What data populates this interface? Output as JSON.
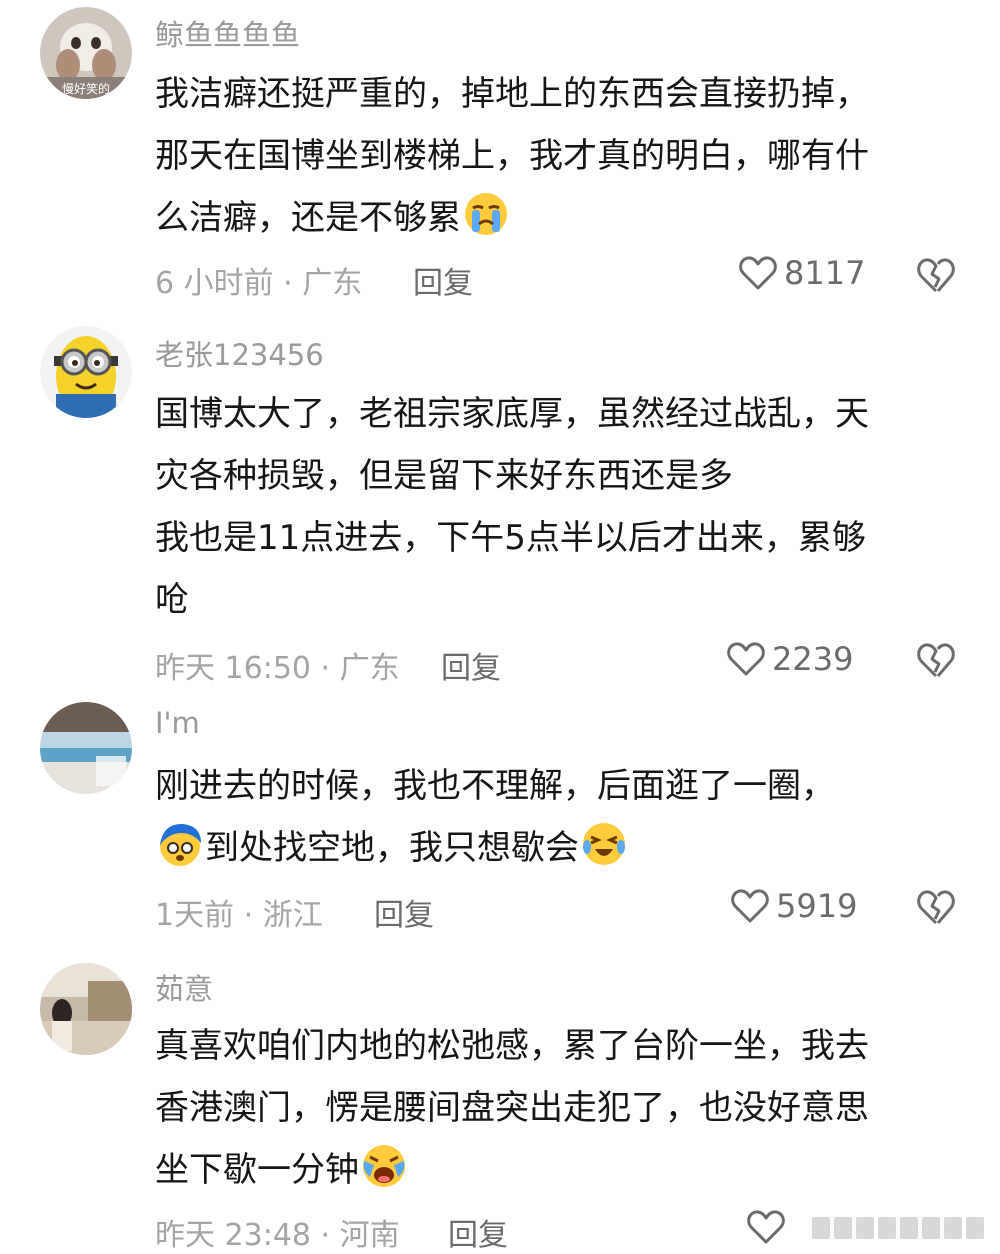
{
  "comments": [
    {
      "username": "鲸鱼鱼鱼鱼",
      "avatar_label": "慢好笑的",
      "lines": [
        "我洁癖还挺严重的，掉地上的东西会直接扔掉，",
        "那天在国博坐到楼梯上，我才真的明白，哪有什",
        "么洁癖，还是不够累"
      ],
      "emojis": [
        "crying-face-emoji"
      ],
      "meta": "6 小时前 · 广东",
      "reply_label": "回复",
      "likes": "8117"
    },
    {
      "username": "老张123456",
      "lines": [
        "国博太大了，老祖宗家底厚，虽然经过战乱，天",
        "灾各种损毁，但是留下来好东西还是多",
        "我也是11点进去，下午5点半以后才出来，累够",
        "呛"
      ],
      "meta": "昨天 16:50 · 广东",
      "reply_label": "回复",
      "likes": "2239"
    },
    {
      "username": "I'm",
      "lines": [
        "刚进去的时候，我也不理解，后面逛了一圈，",
        "到处找空地，我只想歇会"
      ],
      "emojis": [
        "frantic-face-emoji",
        "tearful-laugh-emoji"
      ],
      "meta": "1天前 · 浙江",
      "reply_label": "回复",
      "likes": "5919"
    },
    {
      "username": "茹意",
      "lines": [
        "真喜欢咱们内地的松弛感，累了台阶一坐，我去",
        "香港澳门，愣是腰间盘突出走犯了，也没好意思",
        "坐下歇一分钟"
      ],
      "emojis": [
        "bawling-face-emoji"
      ],
      "meta": "昨天 23:48 · 河南",
      "reply_label": "回复",
      "likes": ""
    }
  ],
  "colors": {
    "text": "#161616",
    "meta": "#a4a4a4",
    "username": "#9a9a9a",
    "icon": "#6b6b6b"
  }
}
